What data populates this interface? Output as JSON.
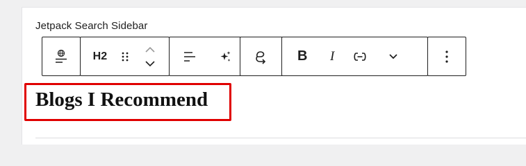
{
  "widget": {
    "title": "Jetpack Search Sidebar"
  },
  "toolbar": {
    "block_type_icon": "globe-icon",
    "heading_level_label": "H2",
    "bold_label": "B",
    "italic_label": "I"
  },
  "block": {
    "heading_text": "Blogs I Recommend"
  },
  "colors": {
    "highlight_border": "#e00000",
    "toolbar_border": "#1e1e1e",
    "background": "#f0f0f1"
  }
}
